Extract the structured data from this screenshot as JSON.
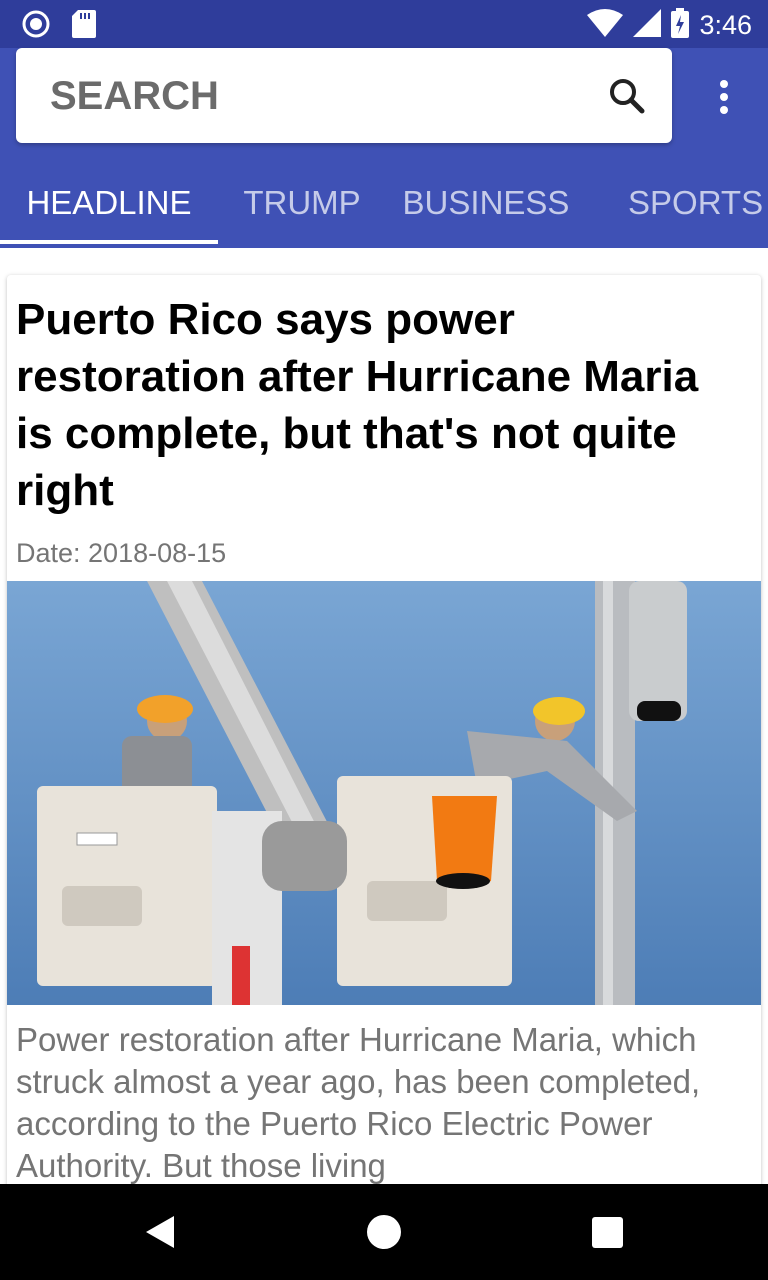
{
  "status_bar": {
    "time": "3:46",
    "left_icons": [
      "notification-circle-icon",
      "sd-card-icon"
    ],
    "right_icons": [
      "wifi-icon",
      "cell-signal-icon",
      "battery-charging-icon"
    ]
  },
  "search": {
    "placeholder": "SEARCH",
    "icon": "search-icon"
  },
  "menu": {
    "icon": "more-vert-icon"
  },
  "tabs": [
    {
      "label": "HEADLINE",
      "active": true
    },
    {
      "label": "TRUMP",
      "active": false
    },
    {
      "label": "BUSINESS",
      "active": false
    },
    {
      "label": "SPORTS",
      "active": false
    }
  ],
  "article": {
    "title": "Puerto Rico says power restoration after Hurricane Maria is complete, but that's not quite right",
    "date": "Date: 2018-08-15",
    "image_alt": "Two utility workers in bucket lifts working on a power pole",
    "description": "Power restoration after Hurricane Maria, which struck almost a year ago, has been completed, according to the Puerto Rico Electric Power Authority. But those living"
  },
  "nav": {
    "icons": [
      "back-icon",
      "home-icon",
      "recents-icon"
    ]
  },
  "colors": {
    "status_bar": "#2f3d9b",
    "app_bar": "#3f51b5",
    "sky": "#6f9bcc",
    "hard_hat": "#f2a12a"
  }
}
